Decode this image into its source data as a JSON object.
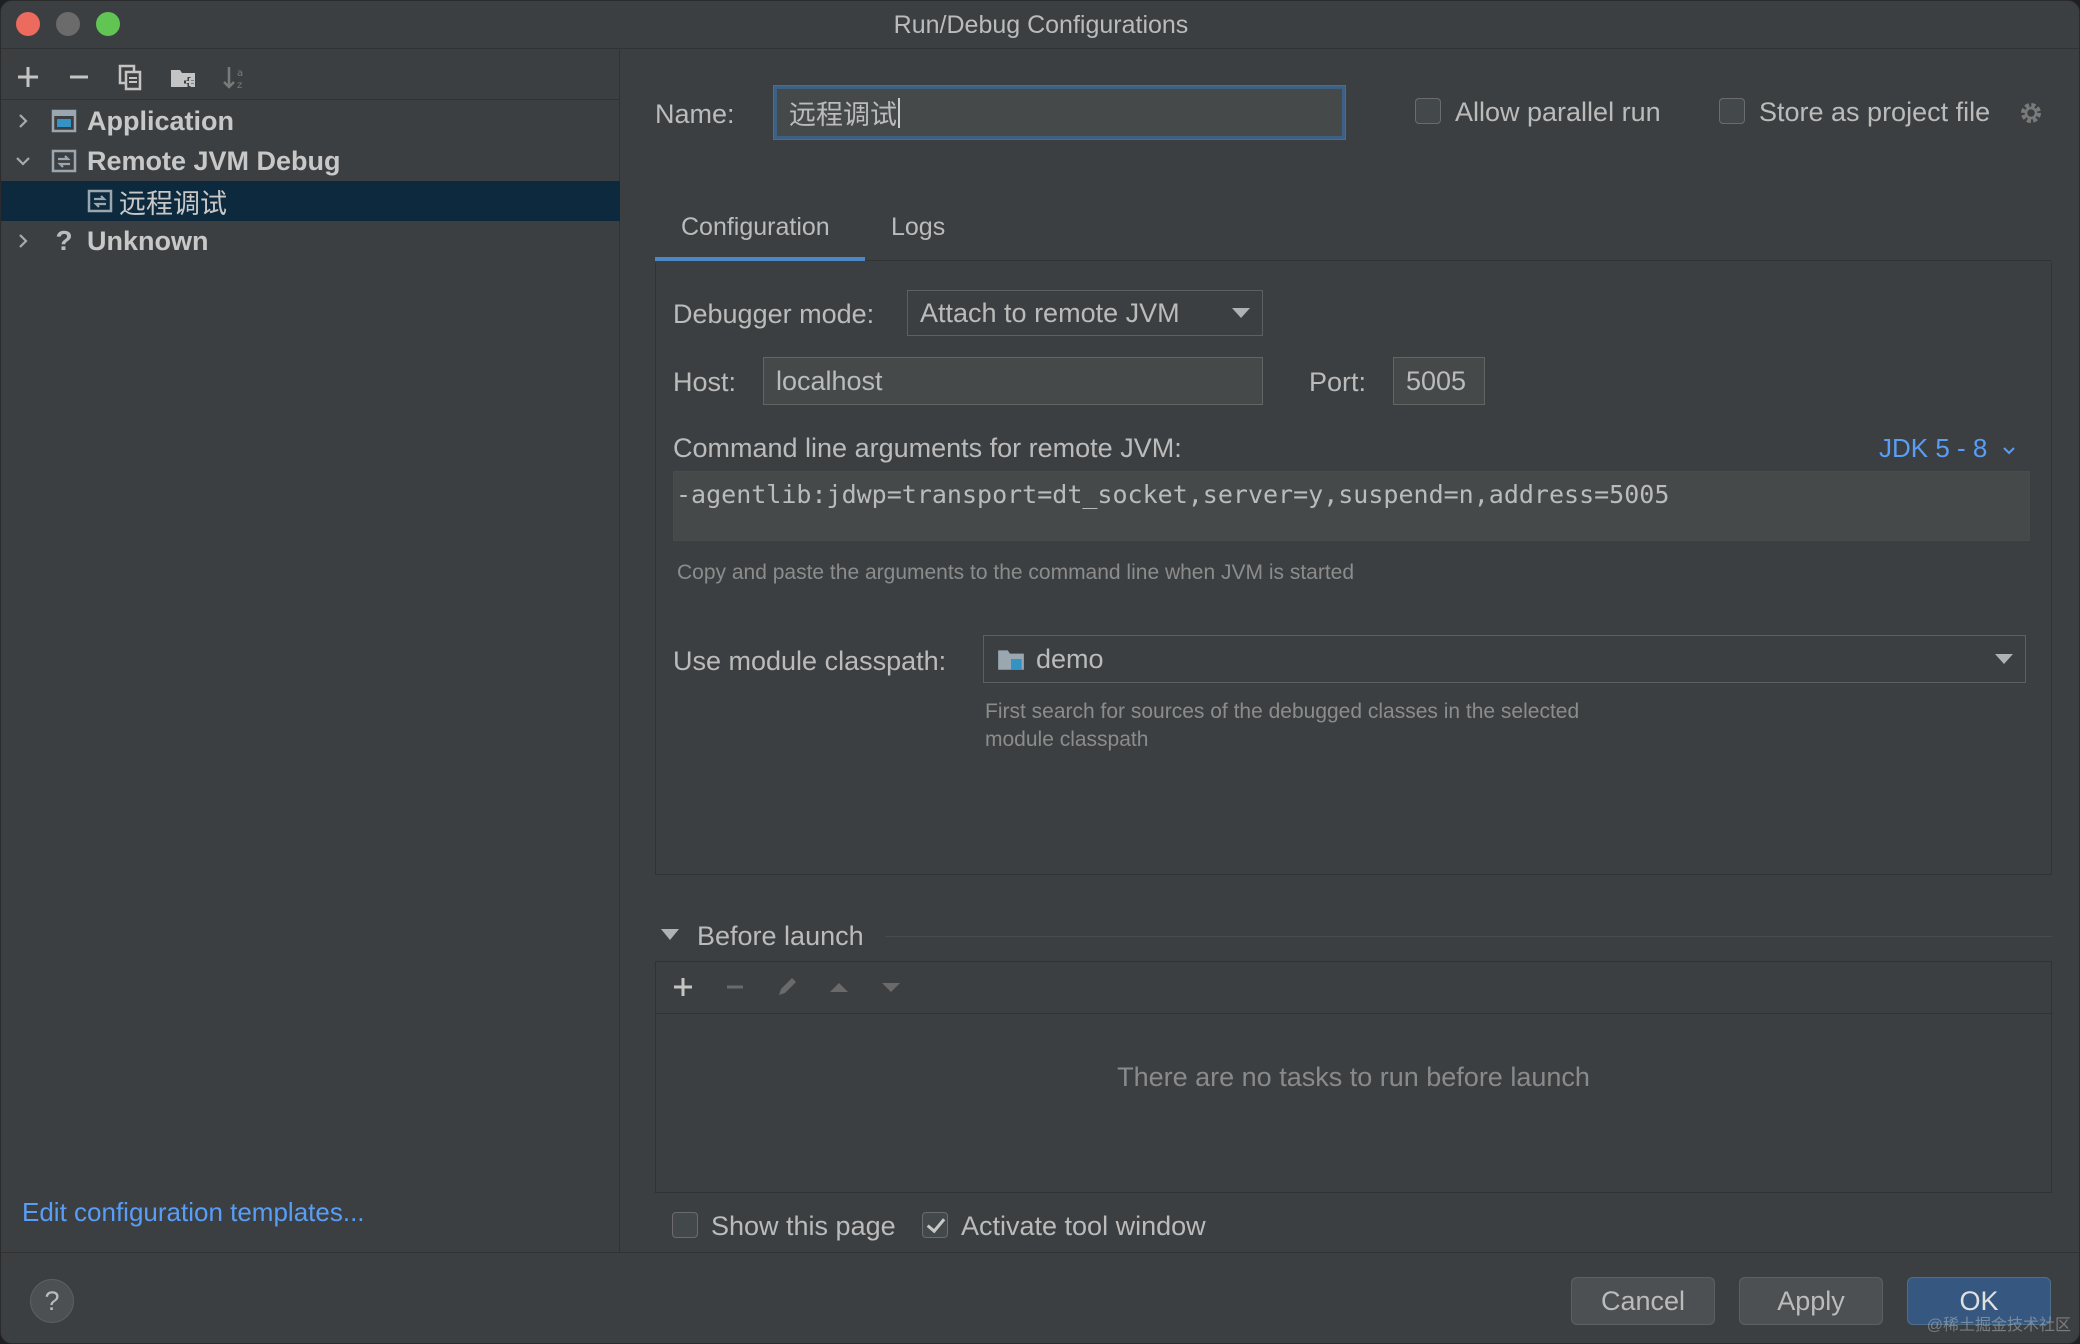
{
  "window": {
    "title": "Run/Debug Configurations"
  },
  "toolbar": {
    "icons": [
      "add-icon",
      "remove-icon",
      "copy-icon",
      "new-folder-icon",
      "sort-icon"
    ]
  },
  "tree": {
    "items": [
      {
        "label": "Application",
        "expanded": false
      },
      {
        "label": "Remote JVM Debug",
        "expanded": true
      },
      {
        "label": "远程调试",
        "selected": true
      },
      {
        "label": "Unknown",
        "expanded": false
      }
    ]
  },
  "edit_templates_link": "Edit configuration templates...",
  "name_field": {
    "label": "Name:",
    "value": "远程调试"
  },
  "allow_parallel": {
    "label": "Allow parallel run",
    "checked": false
  },
  "store_project": {
    "label": "Store as project file",
    "checked": false
  },
  "tabs": [
    {
      "label": "Configuration",
      "active": true
    },
    {
      "label": "Logs",
      "active": false
    }
  ],
  "debugger_mode": {
    "label": "Debugger mode:",
    "value": "Attach to remote JVM"
  },
  "host": {
    "label": "Host:",
    "value": "localhost"
  },
  "port": {
    "label": "Port:",
    "value": "5005"
  },
  "cmdline": {
    "label": "Command line arguments for remote JVM:",
    "jdk_selector": "JDK 5 - 8",
    "value": "-agentlib:jdwp=transport=dt_socket,server=y,suspend=n,address=5005",
    "hint": "Copy and paste the arguments to the command line when JVM is started"
  },
  "module_classpath": {
    "label": "Use module classpath:",
    "value": "demo",
    "hint_line1": "First search for sources of the debugged classes in the selected",
    "hint_line2": "module classpath"
  },
  "before_launch": {
    "header": "Before launch",
    "empty_text": "There are no tasks to run before launch"
  },
  "show_page": {
    "label": "Show this page",
    "checked": false
  },
  "activate_tool": {
    "label": "Activate tool window",
    "checked": true
  },
  "buttons": {
    "cancel": "Cancel",
    "apply": "Apply",
    "ok": "OK",
    "help": "?"
  },
  "watermark": "@稀土掘金技术社区",
  "colors": {
    "accent": "#4a88c7",
    "link": "#589df6",
    "selection": "#0d293e",
    "primary_button": "#365880"
  }
}
